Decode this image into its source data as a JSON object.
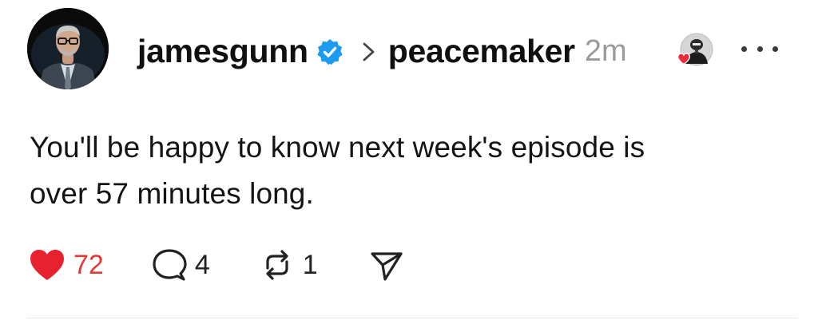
{
  "post": {
    "author": "jamesgunn",
    "verified": true,
    "community": "peacemaker",
    "time": "2m",
    "text_lines": [
      "You'll be happy to know next week's episode is",
      "over 57 minutes long."
    ],
    "actions": {
      "likes": "72",
      "liked": true,
      "comments": "4",
      "reposts": "1"
    }
  },
  "colors": {
    "verified_badge": "#1d9bf0",
    "like_red": "#e53935",
    "time_gray": "#9a9a9a"
  },
  "icons": {
    "verified": "verified-badge-icon",
    "chevron": "chevron-right-icon",
    "more": "more-options-icon",
    "like": "heart-icon",
    "comment": "comment-bubble-icon",
    "repost": "repost-icon",
    "share": "send-icon"
  }
}
